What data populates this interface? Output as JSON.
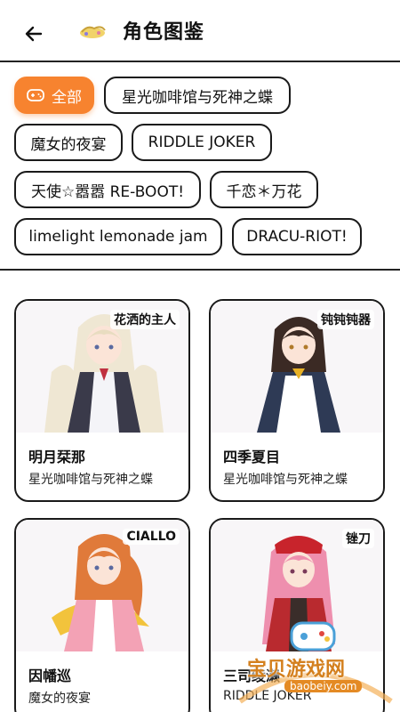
{
  "header": {
    "title": "角色图鉴",
    "back_icon": "arrow-left-icon",
    "logo_icon": "hand-logo-icon"
  },
  "filters": {
    "all_label": "全部",
    "all_icon": "gamepad-icon",
    "items": [
      "星光咖啡馆与死神之蝶",
      "魔女的夜宴",
      "RIDDLE JOKER",
      "天使☆嚣嚣 RE-BOOT!",
      "千恋＊万花",
      "limelight lemonade jam",
      "DRACU-RIOT!"
    ],
    "active_color": "#f7832f"
  },
  "cards": [
    {
      "name": "明月栞那",
      "game": "星光咖啡馆与死神之蝶",
      "tag": "花洒的主人"
    },
    {
      "name": "四季夏目",
      "game": "星光咖啡馆与死神之蝶",
      "tag": "钝钝钝器"
    },
    {
      "name": "因幡巡",
      "game": "魔女的夜宴",
      "tag": "CIALLO"
    },
    {
      "name": "三司绫濑",
      "game": "RIDDLE JOKER",
      "tag": "锉刀"
    }
  ],
  "watermark": {
    "text": "宝贝游戏网",
    "url": "baobeiy.com"
  }
}
